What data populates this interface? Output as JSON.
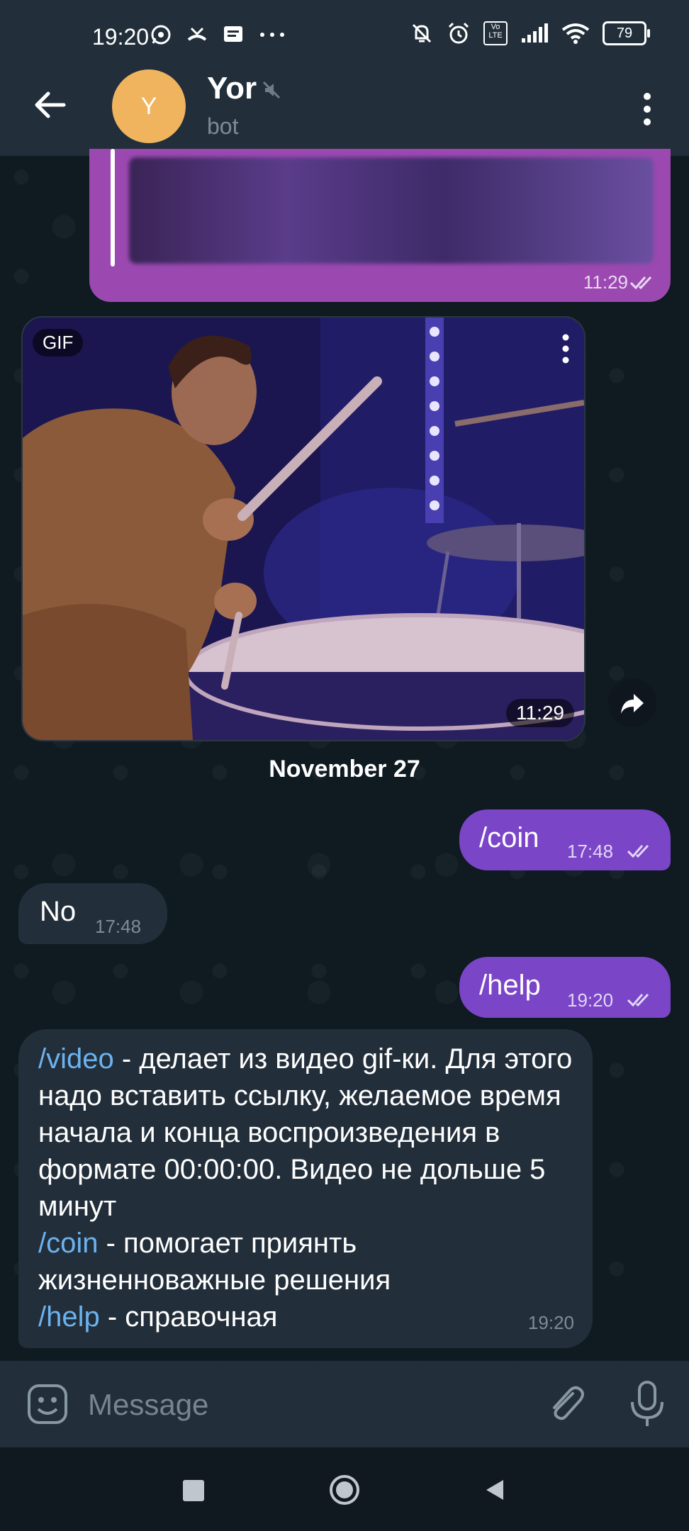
{
  "status_bar": {
    "time": "19:20",
    "battery": "79",
    "volte_label": "Vo LTE"
  },
  "header": {
    "avatar_letter": "Y",
    "title": "Yor",
    "subtitle": "bot"
  },
  "messages": {
    "forwarded_time": "11:29",
    "gif": {
      "badge": "GIF",
      "time": "11:29"
    },
    "date_separator": "November 27",
    "coin_cmd": {
      "text": "/coin",
      "time": "17:48"
    },
    "coin_reply": {
      "text": "No",
      "time": "17:48"
    },
    "help_cmd": {
      "text": "/help",
      "time": "19:20"
    },
    "help_reply": {
      "video_cmd": "/video",
      "video_desc": " - делает из видео gif-ки. Для этого надо вставить ссылку, желаемое время начала и конца воспроизведения в формате 00:00:00. Видео не дольше 5 минут",
      "coin_cmd": "/coin",
      "coin_desc": " - помогает приянть жизненноважные решения",
      "help_cmd": "/help",
      "help_desc": " - справочная",
      "time": "19:20"
    }
  },
  "input": {
    "placeholder": "Message"
  },
  "colors": {
    "header_bg": "#222f3a",
    "chat_bg": "#0f1a21",
    "outgoing_bubble": "#7b45c8",
    "incoming_bubble": "#222e3a",
    "command_link": "#6cb2ee",
    "avatar": "#f0b35e"
  },
  "icons": [
    "whatsapp-icon",
    "missed-call-icon",
    "message-icon",
    "more-icon",
    "mute-notification-icon",
    "alarm-icon",
    "volte-icon",
    "signal-icon",
    "wifi-icon",
    "battery-icon",
    "back-arrow-icon",
    "muted-icon",
    "kebab-menu-icon",
    "forward-icon",
    "double-check-icon",
    "emoji-icon",
    "attach-icon",
    "mic-icon",
    "nav-recents-icon",
    "nav-home-icon",
    "nav-back-icon"
  ]
}
